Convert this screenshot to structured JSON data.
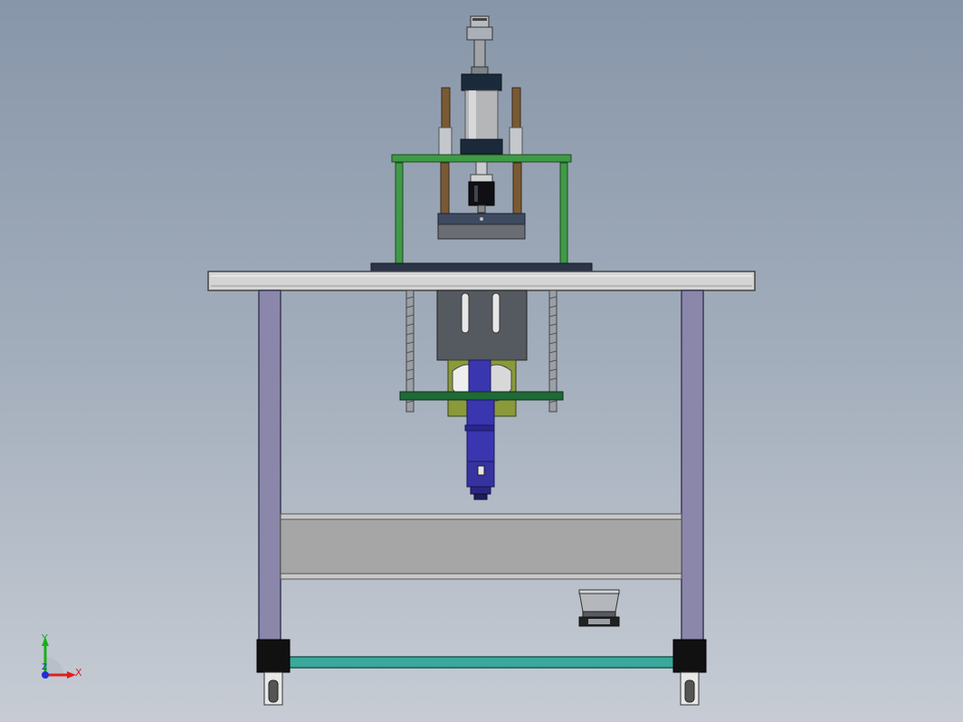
{
  "viewport": {
    "background_top": "#8796a9",
    "background_bottom": "#c7ccd4"
  },
  "model": {
    "description_icon": "cad-machine-assembly-icon",
    "colors": {
      "frame_leg": "#8a87ab",
      "table_top": "#d4d4d4",
      "green_frame": "#3f9a46",
      "cylinder_body": "#b4b6b8",
      "cylinder_cap": "#1a2a3a",
      "blue_spindle": "#3a36b0",
      "crossbar": "#3aa89a",
      "foot_block": "#111111",
      "panel": "#a6a6a6"
    }
  },
  "triad": {
    "x_label": "X",
    "y_label": "Y",
    "z_label": "Z",
    "x_color": "#e02020",
    "y_color": "#18b018",
    "z_color": "#2030d0"
  }
}
